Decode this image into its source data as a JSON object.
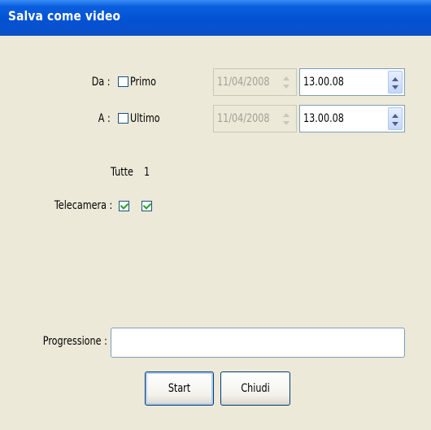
{
  "window": {
    "title": "Salva come video"
  },
  "from": {
    "label": "Da :",
    "checkbox_label": "Primo",
    "checked": false,
    "date": "11/04/2008",
    "time": "13.00.08"
  },
  "to": {
    "label": "A :",
    "checkbox_label": "Ultimo",
    "checked": false,
    "date": "11/04/2008",
    "time": "13.00.08"
  },
  "camera": {
    "label": "Telecamera :",
    "all_label": "Tutte",
    "cam1_label": "1",
    "all_checked": true,
    "cam1_checked": true
  },
  "progress": {
    "label": "Progressione :",
    "value": 0
  },
  "buttons": {
    "start": "Start",
    "close": "Chiudi"
  }
}
